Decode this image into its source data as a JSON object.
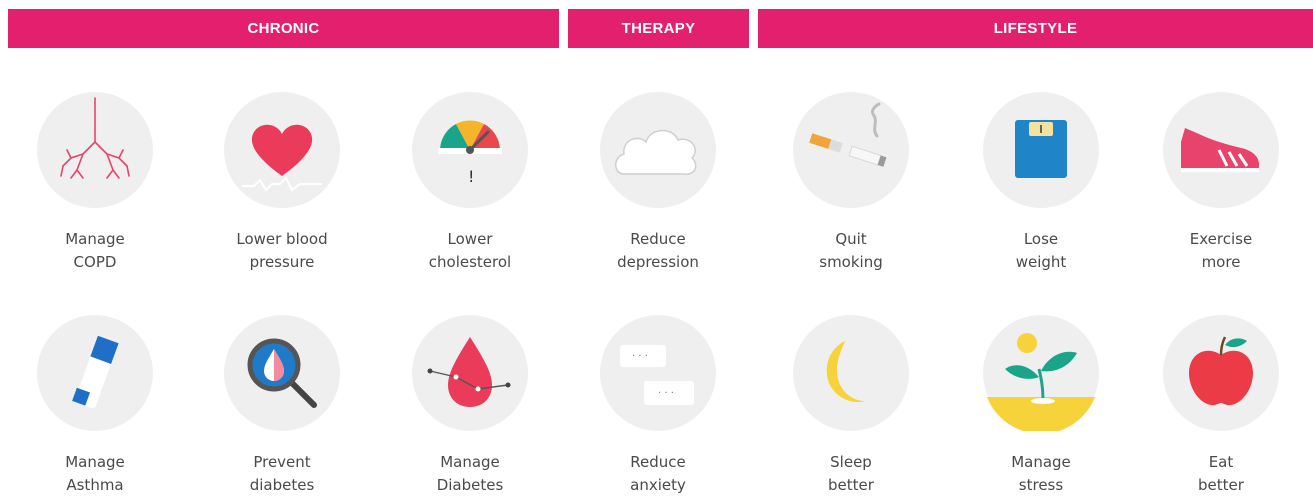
{
  "headers": {
    "chronic": "CHRONIC",
    "therapy": "THERAPY",
    "lifestyle": "LIFESTYLE"
  },
  "colors": {
    "band": "#e3206e",
    "tile_bg": "#efefef",
    "text": "#4a4a4a"
  },
  "items": [
    {
      "line1": "Manage",
      "line2": "COPD",
      "icon": "lungs-icon"
    },
    {
      "line1": "Lower blood",
      "line2": "pressure",
      "icon": "heart-icon"
    },
    {
      "line1": "Lower",
      "line2": "cholesterol",
      "icon": "gauge-icon"
    },
    {
      "line1": "Reduce",
      "line2": "depression",
      "icon": "cloud-icon"
    },
    {
      "line1": "Quit",
      "line2": "smoking",
      "icon": "cigarette-icon"
    },
    {
      "line1": "Lose",
      "line2": "weight",
      "icon": "scale-icon"
    },
    {
      "line1": "Exercise",
      "line2": "more",
      "icon": "sneaker-icon"
    },
    {
      "line1": "Manage",
      "line2": "Asthma",
      "icon": "inhaler-icon"
    },
    {
      "line1": "Prevent",
      "line2": "diabetes",
      "icon": "magnifier-drop-icon"
    },
    {
      "line1": "Manage",
      "line2": "Diabetes",
      "icon": "blood-drop-icon"
    },
    {
      "line1": "Reduce",
      "line2": "anxiety",
      "icon": "chat-bubbles-icon"
    },
    {
      "line1": "Sleep",
      "line2": "better",
      "icon": "moon-icon"
    },
    {
      "line1": "Manage",
      "line2": "stress",
      "icon": "sprout-icon"
    },
    {
      "line1": "Eat",
      "line2": "better",
      "icon": "apple-icon"
    }
  ]
}
